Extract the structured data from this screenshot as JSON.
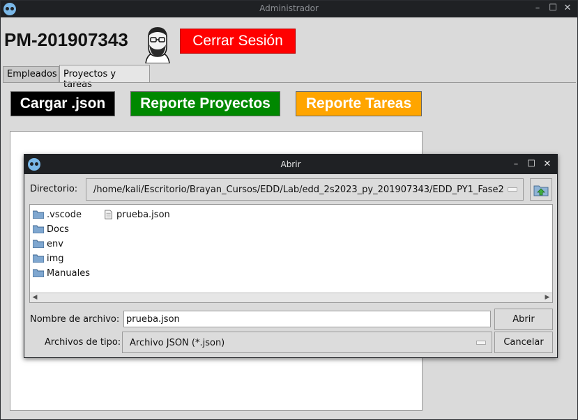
{
  "window": {
    "title": "Administrador"
  },
  "header": {
    "username": "PM-201907343",
    "logout_label": "Cerrar Sesión"
  },
  "tabs": [
    {
      "label": "Empleados",
      "active": false
    },
    {
      "label": "Proyectos y tareas",
      "active": true
    }
  ],
  "toolbar": {
    "load_label": "Cargar .json",
    "report_projects_label": "Reporte Proyectos",
    "report_tasks_label": "Reporte Tareas"
  },
  "colors": {
    "load_bg": "#000000",
    "report_projects_bg": "#008800",
    "report_tasks_bg": "#ffa500",
    "logout_bg": "#ff0000"
  },
  "dialog": {
    "title": "Abrir",
    "directory_label": "Directorio:",
    "directory_path": "/home/kali/Escritorio/Brayan_Cursos/EDD/Lab/edd_2s2023_py_201907343/EDD_PY1_Fase2",
    "folders": [
      ".vscode",
      "Docs",
      "env",
      "img",
      "Manuales"
    ],
    "files": [
      "prueba.json"
    ],
    "filename_label": "Nombre de archivo:",
    "filename_value": "prueba.json",
    "filetype_label": "Archivos de tipo:",
    "filetype_value": "Archivo JSON (*.json)",
    "open_label": "Abrir",
    "cancel_label": "Cancelar"
  }
}
